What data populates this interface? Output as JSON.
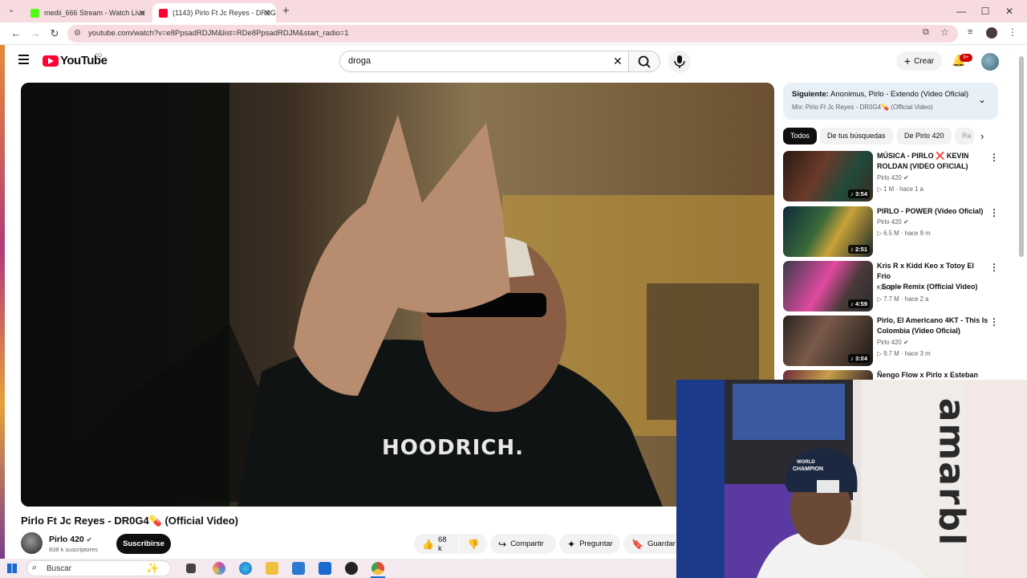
{
  "browser": {
    "tabs": [
      {
        "title": "medii_666 Stream - Watch Live",
        "favicon_color": "#53fc18"
      },
      {
        "title": "(1143) Pirlo Ft Jc Reyes - DR0G4",
        "favicon_color": "#ff0033"
      }
    ],
    "new_tab": "+",
    "window_controls": {
      "minimize": "—",
      "maximize": "☐",
      "close": "✕"
    },
    "url": "youtube.com/watch?v=e8PpsadRDJM&list=RDe8PpsadRDJM&start_radio=1"
  },
  "youtube": {
    "logo_text": "YouTube",
    "country": "CO",
    "search_value": "droga",
    "create_label": "Crear",
    "notif_count": "9+"
  },
  "video": {
    "title": "Pirlo Ft Jc Reyes - DR0G4💊 (Official Video)",
    "shirt_text": "HOODRICH.",
    "channel": "Pirlo 420",
    "subscribers": "838 k suscriptores",
    "subscribe_label": "Suscribirse",
    "likes": "68 k",
    "share_label": "Compartir",
    "ask_label": "Preguntar",
    "save_label": "Guardar"
  },
  "sidebar": {
    "next_label": "Siguiente:",
    "next_title": "Anonimus, Pirlo - Extendo (Video Oficial)",
    "mix_label": "Mix: Pirlo Ft Jc Reyes - DR0G4💊 (Official Video)",
    "chips": [
      "Todos",
      "De tus búsquedas",
      "De Pirlo 420",
      "Ra"
    ],
    "items": [
      {
        "title1": "MÚSICA - PIRLO ❌ KEVIN",
        "title2": "ROLDAN (VIDEO OFICIAL)",
        "channel": "Pirlo 420",
        "views": "1 M",
        "age": "hace 1 a",
        "duration": "3:54",
        "thumb": "linear-gradient(120deg,#2a1a14,#6a3a2a 40%,#1f4a3a 70%,#3a2a20)"
      },
      {
        "title1": "PIRLO - POWER (Video Oficial)",
        "title2": "",
        "channel": "Pirlo 420",
        "views": "6.5 M",
        "age": "hace 9 m",
        "duration": "2:51",
        "thumb": "linear-gradient(120deg,#0e2a3a,#3a6a3a 40%,#c9a23a 60%,#1a2a2a)"
      },
      {
        "title1": "Kris R x Kidd Keo x Totoy El Frio",
        "title2": "- Sople Remix (Official Video)",
        "channel": "Kris R.",
        "views": "7.7 M",
        "age": "hace 2 a",
        "duration": "4:59",
        "thumb": "linear-gradient(120deg,#3a3a4a,#e04aa0 45%,#4a3a3a 70%,#2a2a2a)"
      },
      {
        "title1": "Pirlo, El Americano 4KT - This Is",
        "title2": "Colombia (Video Oficial)",
        "channel": "Pirlo 420",
        "views": "9.7 M",
        "age": "hace 3 m",
        "duration": "3:04",
        "thumb": "linear-gradient(120deg,#2a2420,#7a5a4a 40%,#4a3a30 70%,#1a1614)"
      },
      {
        "title1": "Ñengo Flow x Pirlo x Esteban",
        "title2": "",
        "channel": "",
        "views": "",
        "age": "",
        "duration": "",
        "thumb": "linear-gradient(120deg,#6a2a3a,#c8a04a 50%,#3a2a2a)"
      }
    ]
  },
  "webcam": {
    "wall_text": "amarbl",
    "cap_text1": "WORLD",
    "cap_text2": "CHAMPION"
  },
  "taskbar": {
    "search_placeholder": "Buscar"
  }
}
